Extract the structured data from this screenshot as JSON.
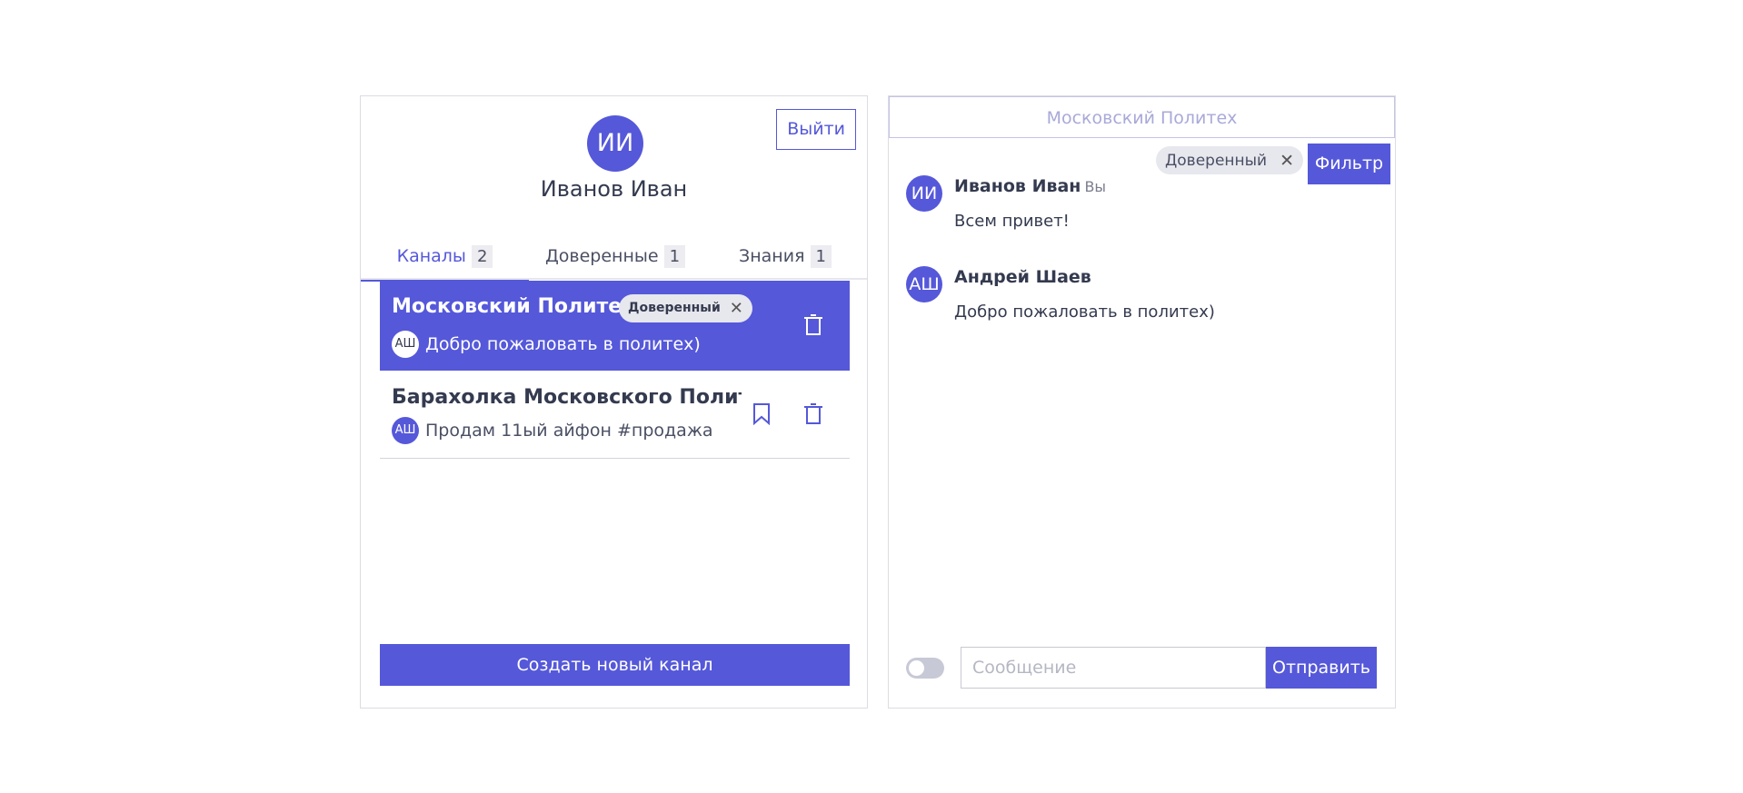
{
  "profile": {
    "avatar_initials": "ИИ",
    "name": "Иванов Иван",
    "logout_label": "Выйти"
  },
  "tabs": [
    {
      "label": "Каналы",
      "count": "2"
    },
    {
      "label": "Доверенные",
      "count": "1"
    },
    {
      "label": "Знания",
      "count": "1"
    }
  ],
  "channels": [
    {
      "title": "Московский Политех",
      "badge": "Доверенный",
      "last_author_initials": "АШ",
      "last_message": "Добро пожаловать в политех)",
      "selected": true
    },
    {
      "title": "Барахолка Московского Полите",
      "last_author_initials": "АШ",
      "last_message": "Продам 11ый айфон #продажа",
      "selected": false
    }
  ],
  "create_channel_label": "Создать новый канал",
  "chat": {
    "channel_name": "Московский Политех",
    "filter_chip": "Доверенный",
    "filter_button": "Фильтр",
    "messages": [
      {
        "initials": "ИИ",
        "author": "Иванов Иван",
        "you_label": "Вы",
        "text": "Всем привет!"
      },
      {
        "initials": "АШ",
        "author": "Андрей Шаев",
        "text": "Добро пожаловать в политех)"
      }
    ],
    "input_placeholder": "Сообщение",
    "send_label": "Отправить"
  },
  "colors": {
    "accent": "#5558d9",
    "text": "#343a4f",
    "border": "#dcdce4",
    "chip_bg": "#e7e7ee"
  },
  "icons": {
    "trash": "trash-icon",
    "bookmark": "bookmark-icon",
    "close": "close-icon"
  }
}
